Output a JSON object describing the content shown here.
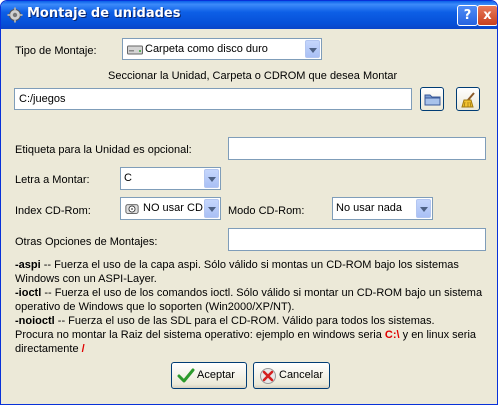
{
  "window": {
    "title": "Montaje de unidades",
    "help_button": "?",
    "close_button": "x"
  },
  "mount_type": {
    "label": "Tipo de Montaje:",
    "selected": "Carpeta como disco duro"
  },
  "select_prompt": "Seccionar la Unidad, Carpeta o CDROM que desea Montar",
  "path": {
    "value": "C:/juegos"
  },
  "drive_label": {
    "label": "Etiqueta para la Unidad es opcional:",
    "value": ""
  },
  "drive_letter": {
    "label": "Letra a Montar:",
    "selected": "C"
  },
  "cdrom_index": {
    "label": "Index CD-Rom:",
    "selected": "NO usar CD"
  },
  "cdrom_mode": {
    "label": "Modo CD-Rom:",
    "selected": "No usar nada"
  },
  "other_options": {
    "label": "Otras Opciones de Montajes:",
    "value": ""
  },
  "help": {
    "aspi_key": "-aspi",
    "aspi_line1": " -- Fuerza el uso de la capa aspi. Sólo válido si montas un CD-ROM bajo los sistemas",
    "aspi_line2": "Windows con un ASPI-Layer.",
    "ioctl_key": "-ioctl",
    "ioctl_line1": " -- Fuerza el uso de los comandos ioctl. Sólo válido si montar un CD-ROM bajo un sistema",
    "ioctl_line2": "operativo de Windows que lo soporten (Win2000/XP/NT).",
    "noioctl_key": "-noioctl",
    "noioctl_line1": " -- Fuerza el uso de las SDL para el CD-ROM. Válido para todos los sistemas.",
    "root_line1_a": "Procura no montar la Raiz del sistema operativo: ejemplo en windows seria ",
    "root_windows": "C:\\",
    "root_line1_b": " y en linux seria",
    "root_line2": "directamente ",
    "root_linux": "/"
  },
  "buttons": {
    "accept": "Aceptar",
    "cancel": "Cancelar"
  },
  "colors": {
    "title_bar": "#0a5fe8",
    "dialog_bg": "#ece9d8",
    "highlight_red": "#e00000"
  }
}
